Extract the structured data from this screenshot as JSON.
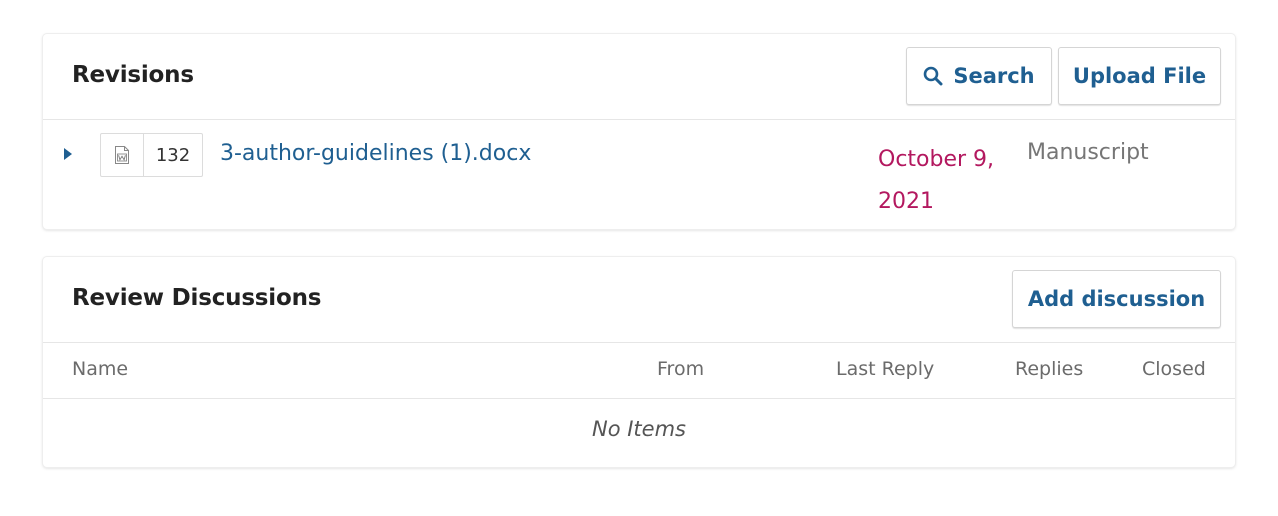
{
  "revisions": {
    "title": "Revisions",
    "search_label": "Search",
    "upload_label": "Upload File",
    "file": {
      "id": "132",
      "name": "3-author-guidelines (1).docx",
      "date": "October 9, 2021",
      "stage": "Manuscript",
      "type_icon": "word-document-icon"
    }
  },
  "discussions": {
    "title": "Review Discussions",
    "add_label": "Add discussion",
    "columns": {
      "name": "Name",
      "from": "From",
      "last_reply": "Last Reply",
      "replies": "Replies",
      "closed": "Closed"
    },
    "empty_text": "No Items"
  },
  "colors": {
    "link": "#1f5f91",
    "date": "#b3185f",
    "muted": "#767676"
  }
}
